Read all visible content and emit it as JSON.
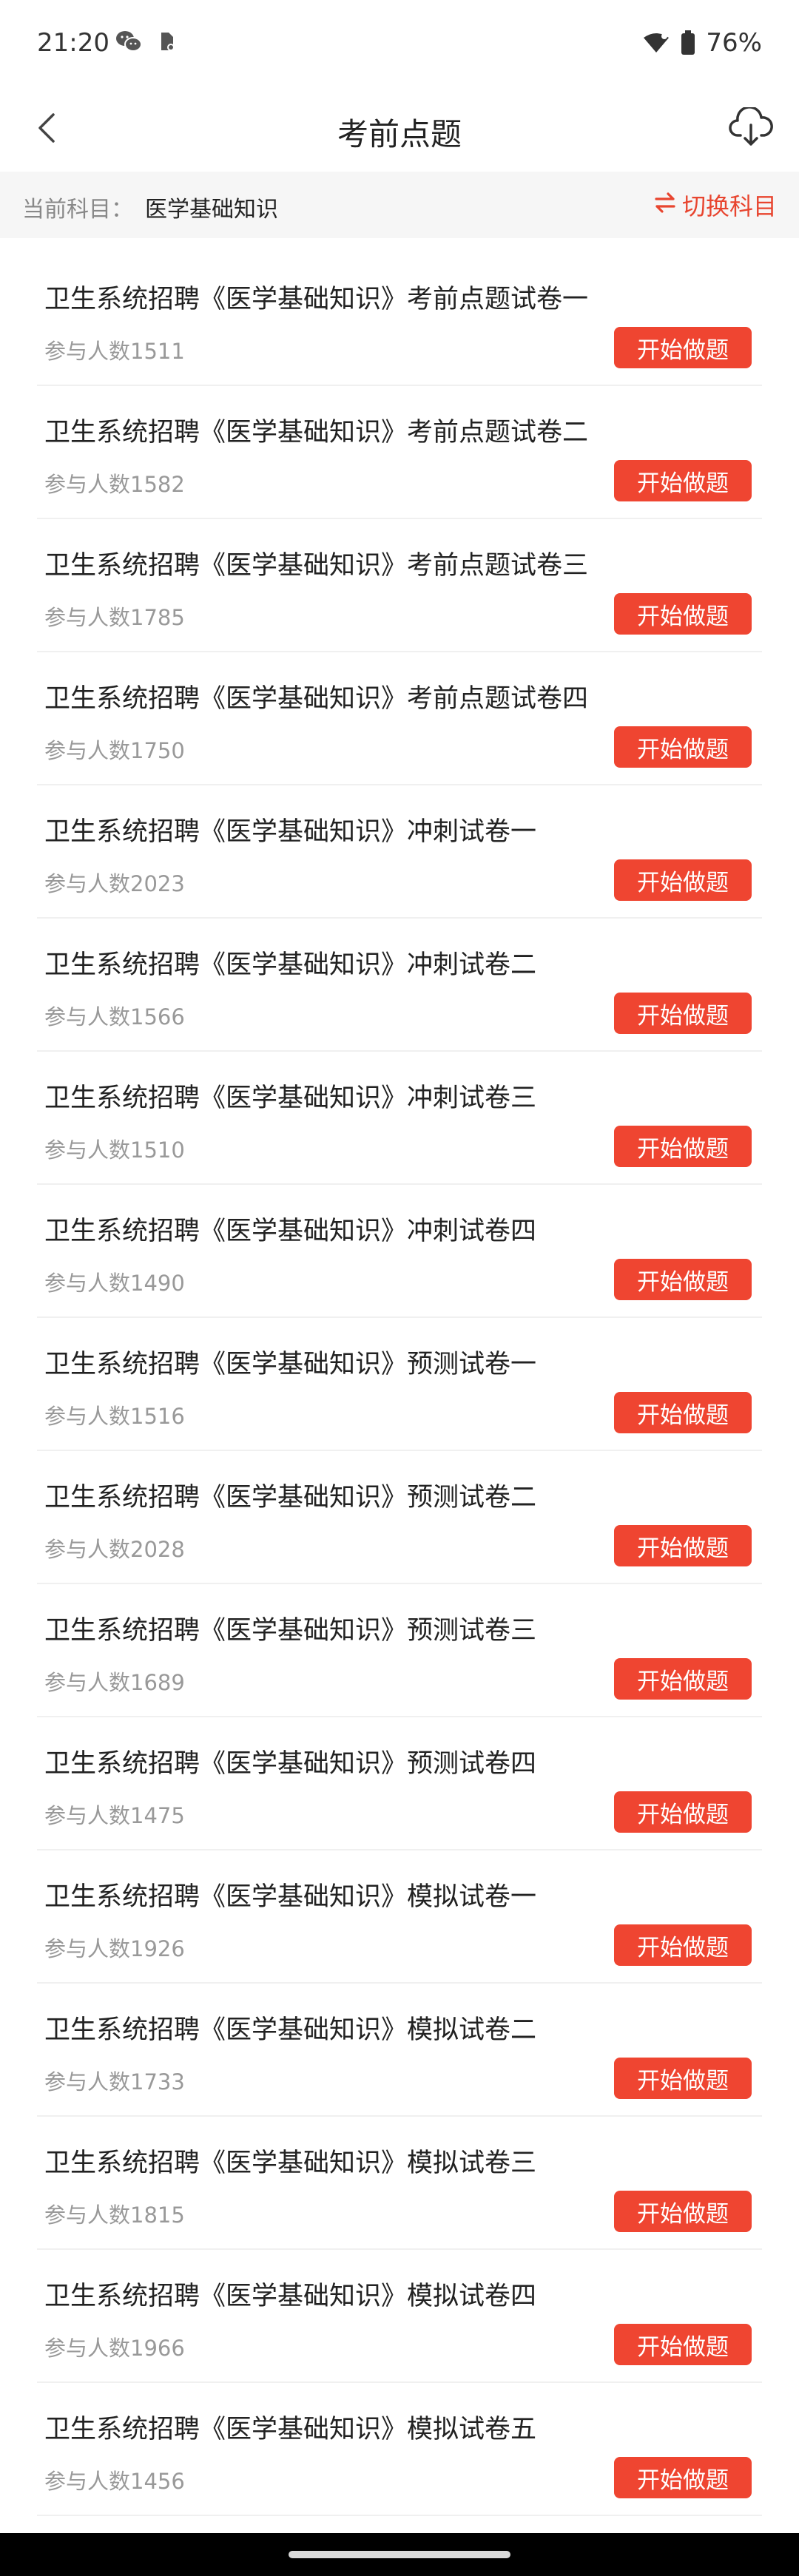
{
  "status_bar": {
    "time": "21:20",
    "battery": "76%",
    "icons_left": [
      "wechat-icon",
      "notification-icon"
    ],
    "icons_right": [
      "wifi-icon",
      "battery-icon"
    ]
  },
  "nav": {
    "title": "考前点题",
    "back_icon": "chevron-left-icon",
    "download_icon": "cloud-download-icon"
  },
  "subject": {
    "label": "当前科目：",
    "value": "医学基础知识",
    "switch_label": "切换科目",
    "accent_color": "#e8452f"
  },
  "items": [
    {
      "title": "卫生系统招聘《医学基础知识》考前点题试卷一",
      "count": "参与人数1511",
      "button": "开始做题"
    },
    {
      "title": "卫生系统招聘《医学基础知识》考前点题试卷二",
      "count": "参与人数1582",
      "button": "开始做题"
    },
    {
      "title": "卫生系统招聘《医学基础知识》考前点题试卷三",
      "count": "参与人数1785",
      "button": "开始做题"
    },
    {
      "title": "卫生系统招聘《医学基础知识》考前点题试卷四",
      "count": "参与人数1750",
      "button": "开始做题"
    },
    {
      "title": "卫生系统招聘《医学基础知识》冲刺试卷一",
      "count": "参与人数2023",
      "button": "开始做题"
    },
    {
      "title": "卫生系统招聘《医学基础知识》冲刺试卷二",
      "count": "参与人数1566",
      "button": "开始做题"
    },
    {
      "title": "卫生系统招聘《医学基础知识》冲刺试卷三",
      "count": "参与人数1510",
      "button": "开始做题"
    },
    {
      "title": "卫生系统招聘《医学基础知识》冲刺试卷四",
      "count": "参与人数1490",
      "button": "开始做题"
    },
    {
      "title": "卫生系统招聘《医学基础知识》预测试卷一",
      "count": "参与人数1516",
      "button": "开始做题"
    },
    {
      "title": "卫生系统招聘《医学基础知识》预测试卷二",
      "count": "参与人数2028",
      "button": "开始做题"
    },
    {
      "title": "卫生系统招聘《医学基础知识》预测试卷三",
      "count": "参与人数1689",
      "button": "开始做题"
    },
    {
      "title": "卫生系统招聘《医学基础知识》预测试卷四",
      "count": "参与人数1475",
      "button": "开始做题"
    },
    {
      "title": "卫生系统招聘《医学基础知识》模拟试卷一",
      "count": "参与人数1926",
      "button": "开始做题"
    },
    {
      "title": "卫生系统招聘《医学基础知识》模拟试卷二",
      "count": "参与人数1733",
      "button": "开始做题"
    },
    {
      "title": "卫生系统招聘《医学基础知识》模拟试卷三",
      "count": "参与人数1815",
      "button": "开始做题"
    },
    {
      "title": "卫生系统招聘《医学基础知识》模拟试卷四",
      "count": "参与人数1966",
      "button": "开始做题"
    },
    {
      "title": "卫生系统招聘《医学基础知识》模拟试卷五",
      "count": "参与人数1456",
      "button": "开始做题"
    }
  ]
}
